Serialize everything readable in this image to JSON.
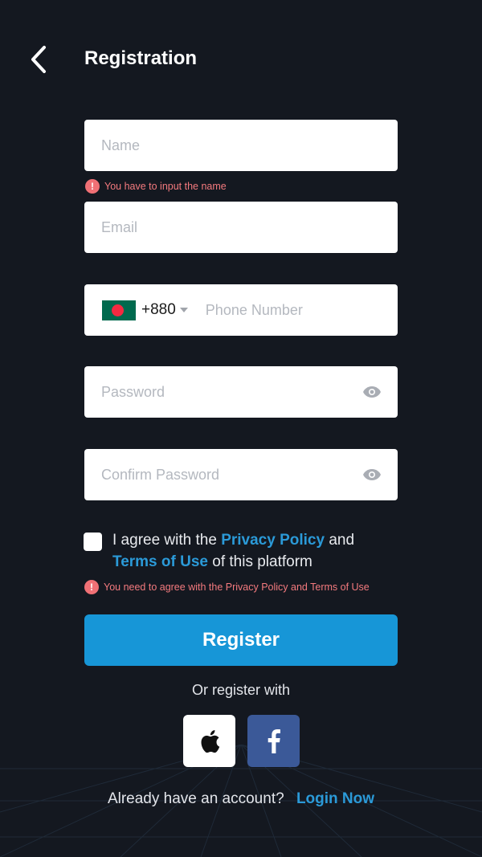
{
  "header": {
    "title": "Registration"
  },
  "form": {
    "name": {
      "value": "",
      "placeholder": "Name"
    },
    "name_error": "You have to input the name",
    "email": {
      "value": "",
      "placeholder": "Email"
    },
    "phone": {
      "country_flag": "bangladesh-flag",
      "dial_code": "+880",
      "value": "",
      "placeholder": "Phone Number"
    },
    "password": {
      "value": "",
      "placeholder": "Password"
    },
    "confirm_password": {
      "value": "",
      "placeholder": "Confirm Password"
    },
    "agree": {
      "checked": false,
      "prefix": "I agree with the ",
      "privacy_link": "Privacy Policy",
      "middle": " and ",
      "terms_link": "Terms of Use",
      "suffix": " of this platform"
    },
    "agree_error": "You need to agree with the Privacy Policy and Terms of Use",
    "register_label": "Register"
  },
  "social": {
    "label": "Or register with",
    "buttons": [
      "apple-icon",
      "facebook-icon"
    ]
  },
  "footer": {
    "question": "Already have an account?",
    "login_label": "Login Now"
  },
  "colors": {
    "background": "#141820",
    "accent": "#1796d7",
    "link": "#2b9ad8",
    "error": "#f07075",
    "facebook": "#3b5998"
  }
}
